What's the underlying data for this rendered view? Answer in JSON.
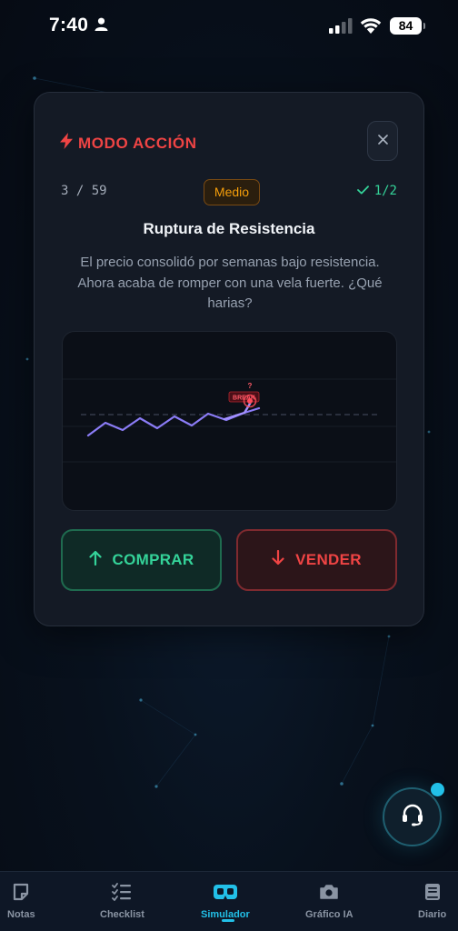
{
  "status": {
    "time": "7:40",
    "battery": "84"
  },
  "mode": {
    "title": "MODO ACCIÓN"
  },
  "progress": {
    "text": "3 / 59"
  },
  "difficulty": "Medio",
  "score": "1/2",
  "scenario": {
    "title": "Ruptura de Resistencia",
    "description": "El precio consolidó por semanas bajo resistencia. Ahora acaba de romper con una vela fuerte. ¿Qué harias?"
  },
  "chart": {
    "breakout_label": "BREAK",
    "question_mark": "?"
  },
  "actions": {
    "buy": "COMPRAR",
    "sell": "VENDER"
  },
  "nav": {
    "items": [
      {
        "label": "Notas",
        "icon": "notes-icon"
      },
      {
        "label": "Checklist",
        "icon": "checklist-icon"
      },
      {
        "label": "Simulador",
        "icon": "vr-icon"
      },
      {
        "label": "Gráfico IA",
        "icon": "camera-icon"
      },
      {
        "label": "Diario",
        "icon": "journal-icon"
      }
    ],
    "active": "Simulador"
  },
  "colors": {
    "accent": "#22c0e8",
    "buy": "#34d399",
    "sell": "#ef4444",
    "difficulty": "#f59e0b",
    "price_line": "#8b7cf6"
  }
}
